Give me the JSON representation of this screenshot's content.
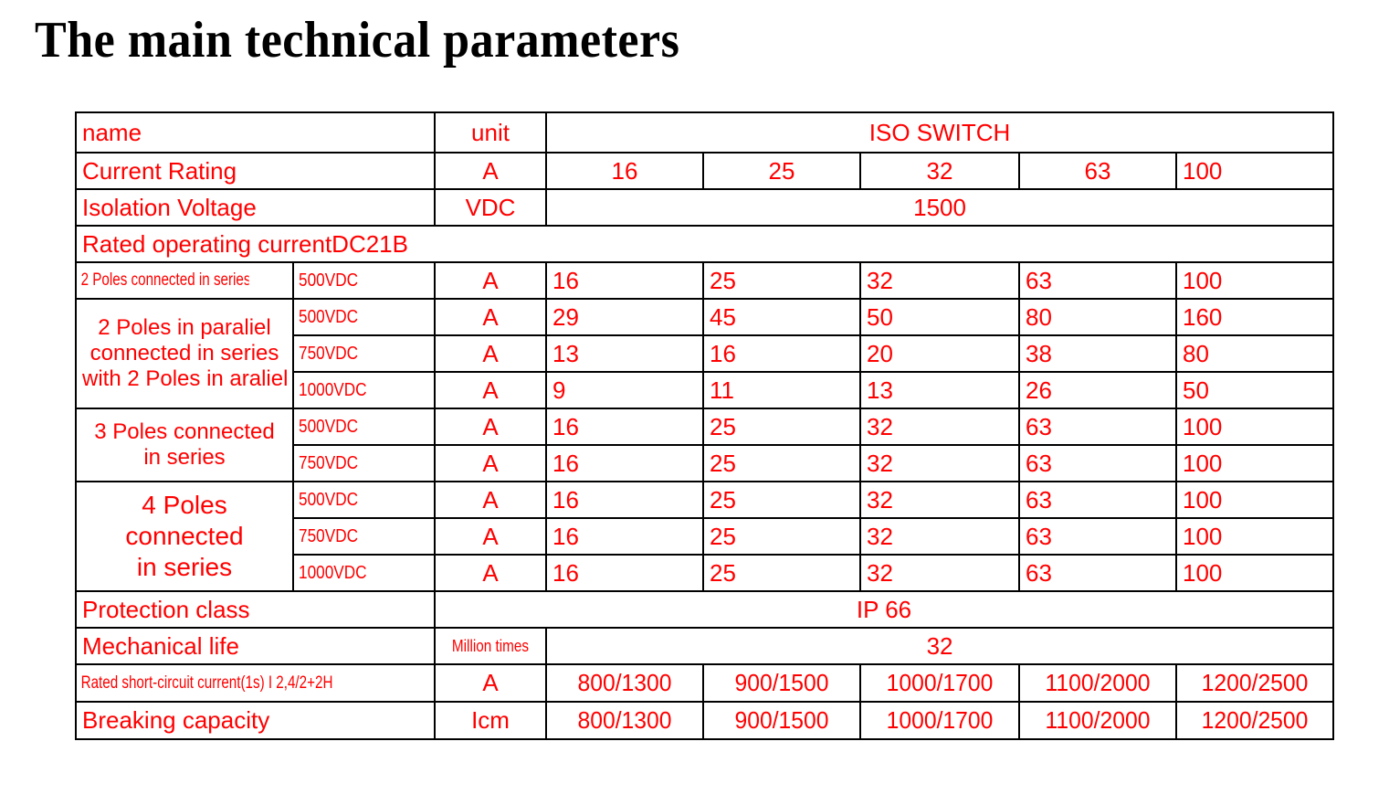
{
  "title": "The main technical parameters",
  "colors": {
    "text": "#ff0000",
    "title": "#000000",
    "border": "#000000",
    "background": "#ffffff"
  },
  "table": {
    "header": {
      "name": "name",
      "unit": "unit",
      "group": "ISO SWITCH"
    },
    "rows": {
      "current_rating": {
        "label": "Current Rating",
        "unit": "A",
        "values": [
          "16",
          "25",
          "32",
          "63",
          "100"
        ]
      },
      "isolation_voltage": {
        "label": "Isolation Voltage",
        "unit": "VDC",
        "value": "1500"
      },
      "section_title": "Rated operating currentDC21B",
      "two_poles_series": {
        "label": "2 Poles connected in series",
        "voltage": "500VDC",
        "unit": "A",
        "values": [
          "16",
          "25",
          "32",
          "63",
          "100"
        ]
      },
      "two_poles_parallel": {
        "label_line1": "2 Poles in paraliel",
        "label_line2": "connected in series",
        "label_line3": "with 2 Poles in araliel",
        "sub": [
          {
            "voltage": "500VDC",
            "unit": "A",
            "values": [
              "29",
              "45",
              "50",
              "80",
              "160"
            ]
          },
          {
            "voltage": "750VDC",
            "unit": "A",
            "values": [
              "13",
              "16",
              "20",
              "38",
              "80"
            ]
          },
          {
            "voltage": "1000VDC",
            "unit": "A",
            "values": [
              "9",
              "11",
              "13",
              "26",
              "50"
            ]
          }
        ]
      },
      "three_poles_series": {
        "label_line1": "3 Poles connected",
        "label_line2": "in series",
        "sub": [
          {
            "voltage": "500VDC",
            "unit": "A",
            "values": [
              "16",
              "25",
              "32",
              "63",
              "100"
            ]
          },
          {
            "voltage": "750VDC",
            "unit": "A",
            "values": [
              "16",
              "25",
              "32",
              "63",
              "100"
            ]
          }
        ]
      },
      "four_poles_series": {
        "label_line1": "4 Poles",
        "label_line2": "connected",
        "label_line3": "in series",
        "sub": [
          {
            "voltage": "500VDC",
            "unit": "A",
            "values": [
              "16",
              "25",
              "32",
              "63",
              "100"
            ]
          },
          {
            "voltage": "750VDC",
            "unit": "A",
            "values": [
              "16",
              "25",
              "32",
              "63",
              "100"
            ]
          },
          {
            "voltage": "1000VDC",
            "unit": "A",
            "values": [
              "16",
              "25",
              "32",
              "63",
              "100"
            ]
          }
        ]
      },
      "protection_class": {
        "label": "Protection class",
        "value": "IP 66"
      },
      "mechanical_life": {
        "label": "Mechanical life",
        "unit": "Million times",
        "value": "32"
      },
      "short_circuit": {
        "label": "Rated short-circuit current(1s) I 2,4/2+2H",
        "unit": "A",
        "values": [
          "800/1300",
          "900/1500",
          "1000/1700",
          "1100/2000",
          "1200/2500"
        ]
      },
      "breaking_capacity": {
        "label": "Breaking capacity",
        "unit": "Icm",
        "values": [
          "800/1300",
          "900/1500",
          "1000/1700",
          "1100/2000",
          "1200/2500"
        ]
      }
    }
  }
}
